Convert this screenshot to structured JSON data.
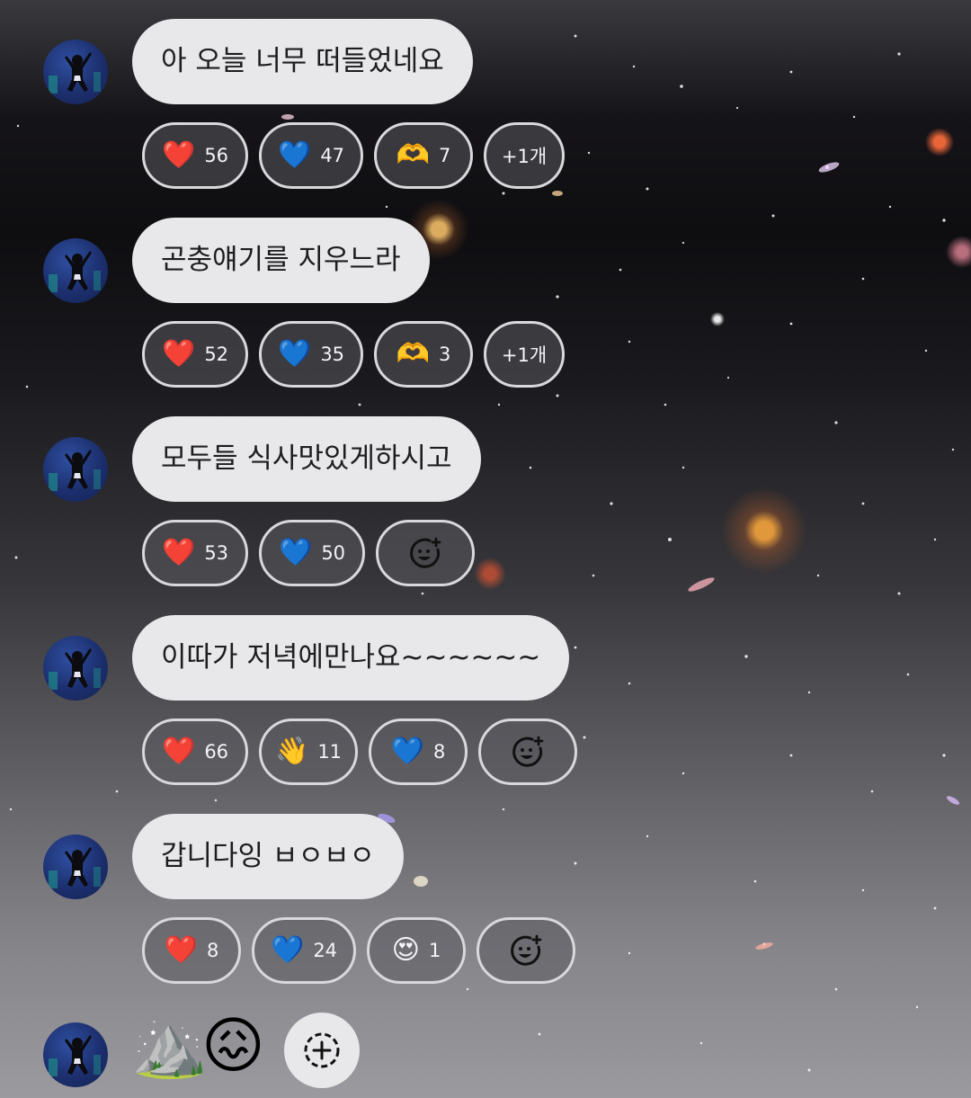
{
  "messages": [
    {
      "text": "아 오늘 너무 떠들었네요",
      "reactions": [
        {
          "icon": "heart-red",
          "glyph": "❤️",
          "count": "56"
        },
        {
          "icon": "heart-blue",
          "glyph": "💙",
          "count": "47"
        },
        {
          "icon": "heart-hands",
          "glyph": "🫶",
          "count": "7"
        },
        {
          "more": "+1개"
        }
      ]
    },
    {
      "text": "곤충얘기를 지우느라",
      "reactions": [
        {
          "icon": "heart-red",
          "glyph": "❤️",
          "count": "52"
        },
        {
          "icon": "heart-blue",
          "glyph": "💙",
          "count": "35"
        },
        {
          "icon": "heart-hands",
          "glyph": "🫶",
          "count": "3"
        },
        {
          "more": "+1개"
        }
      ]
    },
    {
      "text": "모두들 식사맛있게하시고",
      "reactions": [
        {
          "icon": "heart-red",
          "glyph": "❤️",
          "count": "53"
        },
        {
          "icon": "heart-blue",
          "glyph": "💙",
          "count": "50"
        },
        {
          "add": "add-reaction"
        }
      ]
    },
    {
      "text": "이따가 저녁에만나요~~~~~~",
      "reactions": [
        {
          "icon": "heart-red",
          "glyph": "❤️",
          "count": "66"
        },
        {
          "icon": "waving-hand",
          "glyph": "👋",
          "count": "11"
        },
        {
          "icon": "heart-blue",
          "glyph": "💙",
          "count": "8"
        },
        {
          "add": "add-reaction"
        }
      ]
    },
    {
      "text": "갑니다잉 ㅂㅇㅂㅇ",
      "reactions": [
        {
          "icon": "heart-red",
          "glyph": "❤️",
          "count": "8"
        },
        {
          "icon": "heart-blue",
          "glyph": "💙",
          "count": "24"
        },
        {
          "icon": "heart-eyes",
          "glyph": "😍",
          "count": "1"
        },
        {
          "add": "add-reaction"
        }
      ]
    }
  ],
  "last_message": {
    "emojis": [
      {
        "icon": "mountain",
        "glyph": "⛰️"
      },
      {
        "icon": "confounded-face",
        "glyph": "😖"
      }
    ],
    "add": "add-reaction"
  },
  "colors": {
    "bubble": "#e8e8ea",
    "chip_border": "#d9d9dc",
    "chip_fill": "#5a5a5f"
  }
}
